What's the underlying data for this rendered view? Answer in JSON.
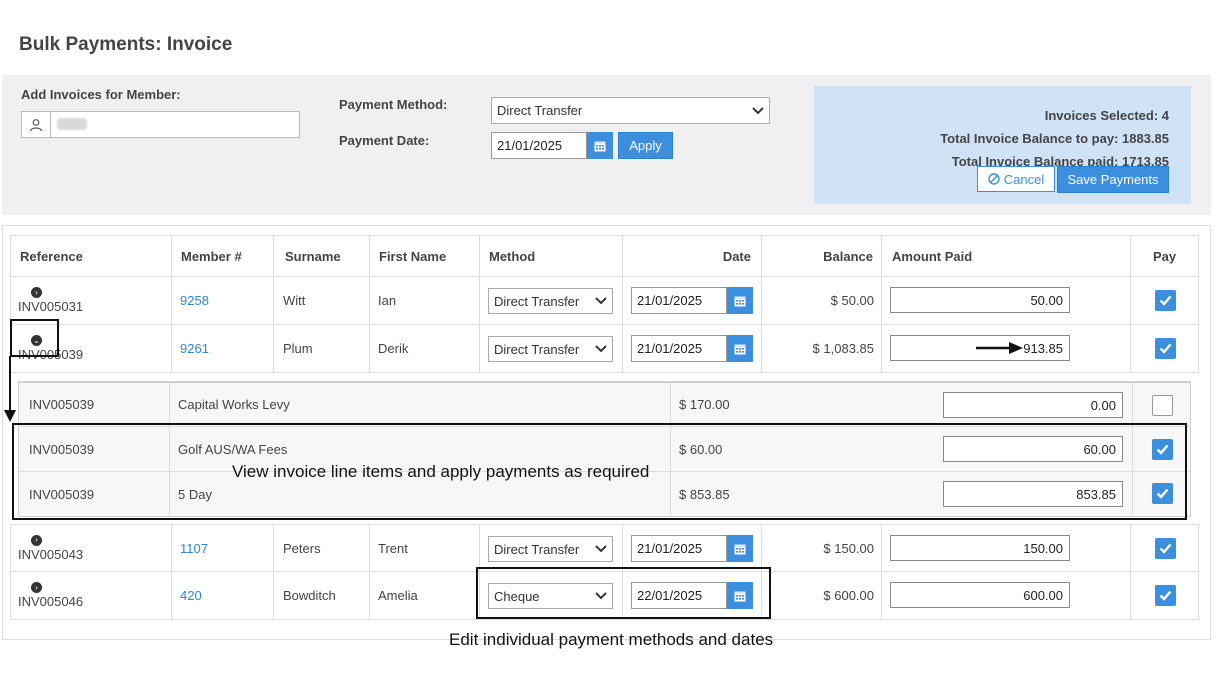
{
  "page": {
    "title": "Bulk Payments: Invoice"
  },
  "form": {
    "member_label": "Add Invoices for Member:",
    "payment_method_label": "Payment Method:",
    "payment_method_value": "Direct Transfer",
    "payment_date_label": "Payment Date:",
    "payment_date_value": "21/01/2025",
    "apply_label": "Apply"
  },
  "summary": {
    "invoices_selected": "Invoices Selected: 4",
    "total_to_pay": "Total Invoice Balance to pay: 1883.85",
    "total_paid": "Total Invoice Balance paid: 1713.85",
    "cancel_label": "Cancel",
    "save_label": "Save Payments"
  },
  "table": {
    "headers": [
      "Reference",
      "Member #",
      "Surname",
      "First Name",
      "Method",
      "Date",
      "Balance",
      "Amount Paid",
      "Pay"
    ],
    "rows": [
      {
        "reference": "INV005031",
        "member": "9258",
        "surname": "Witt",
        "first_name": "Ian",
        "method": "Direct Transfer",
        "date": "21/01/2025",
        "balance": "$ 50.00",
        "amount_paid": "50.00",
        "pay": true,
        "expanded": false
      },
      {
        "reference": "INV005039",
        "member": "9261",
        "surname": "Plum",
        "first_name": "Derik",
        "method": "Direct Transfer",
        "date": "21/01/2025",
        "balance": "$ 1,083.85",
        "amount_paid": "913.85",
        "pay": true,
        "expanded": true
      },
      {
        "reference": "INV005043",
        "member": "1107",
        "surname": "Peters",
        "first_name": "Trent",
        "method": "Direct Transfer",
        "date": "21/01/2025",
        "balance": "$ 150.00",
        "amount_paid": "150.00",
        "pay": true,
        "expanded": false
      },
      {
        "reference": "INV005046",
        "member": "420",
        "surname": "Bowditch",
        "first_name": "Amelia",
        "method": "Cheque",
        "date": "22/01/2025",
        "balance": "$ 600.00",
        "amount_paid": "600.00",
        "pay": true,
        "expanded": false
      }
    ],
    "line_items": [
      {
        "reference": "INV005039",
        "description": "Capital Works Levy",
        "amount": "$ 170.00",
        "paid": "0.00",
        "pay": false
      },
      {
        "reference": "INV005039",
        "description": "Golf AUS/WA Fees",
        "amount": "$ 60.00",
        "paid": "60.00",
        "pay": true
      },
      {
        "reference": "INV005039",
        "description": "5 Day",
        "amount": "$ 853.85",
        "paid": "853.85",
        "pay": true
      }
    ]
  },
  "annotations": {
    "line_items_note": "View invoice line items and apply payments as required",
    "methods_note": "Edit individual payment methods and dates"
  },
  "colors": {
    "accent": "#3c8fdd",
    "summary_bg": "#cfe2f6",
    "link": "#2f86d6"
  }
}
